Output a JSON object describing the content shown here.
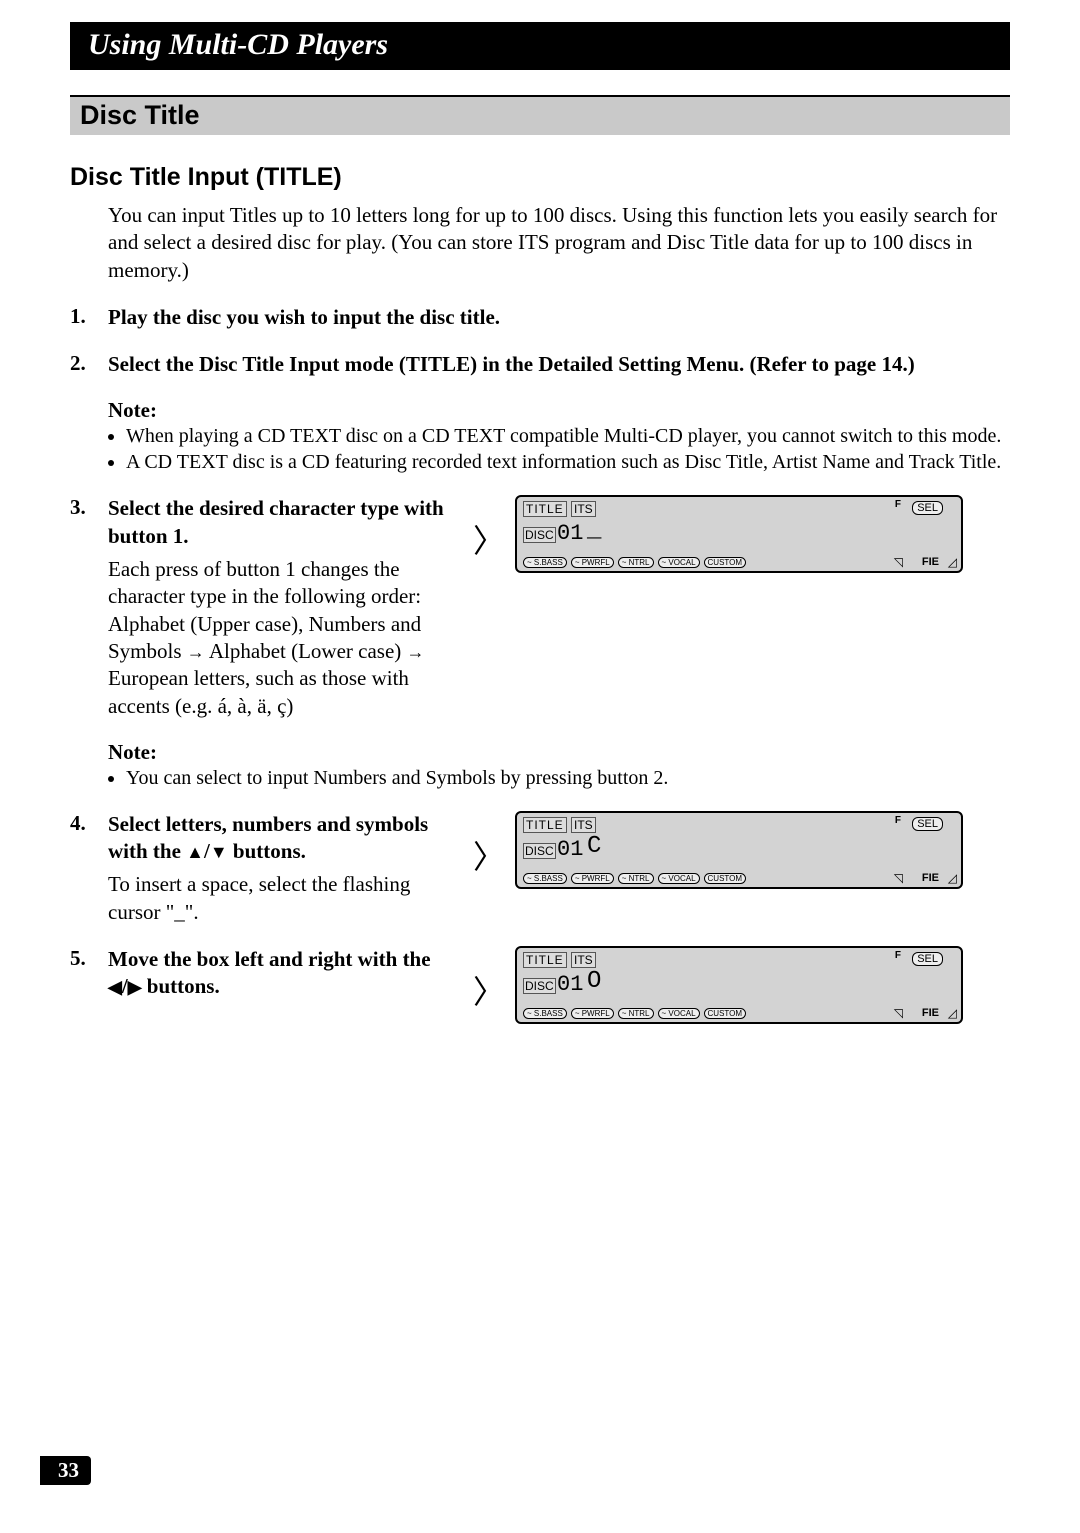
{
  "chapter_title": "Using Multi-CD Players",
  "section_title": "Disc Title",
  "subsection_title": "Disc Title Input (TITLE)",
  "intro_text": "You can input Titles up to 10 letters long for up to 100 discs. Using this function lets you easily search for and select a desired disc for play. (You can store ITS program and Disc Title data for up to 100 discs in memory.)",
  "steps": {
    "s1": {
      "num": "1.",
      "title": "Play the disc you wish to input the disc title."
    },
    "s2": {
      "num": "2.",
      "title": "Select the Disc Title Input mode (TITLE) in the Detailed Setting Menu. (Refer to page 14.)"
    },
    "note1": {
      "label": "Note:",
      "items": {
        "a": "When playing a CD TEXT disc on a CD TEXT compatible Multi-CD player, you cannot switch to this mode.",
        "b": "A CD TEXT disc is a CD featuring recorded text information such as Disc Title, Artist Name and Track Title."
      }
    },
    "s3": {
      "num": "3.",
      "title": "Select the desired character type with button 1.",
      "desc_a": "Each press of button 1 changes the character type in the following order:",
      "desc_b1": "Alphabet (Upper case), Numbers and Symbols ",
      "desc_b2": " Alphabet (Lower case) ",
      "desc_b3": " European letters, such as those with accents (e.g. á, à, ä, ç)"
    },
    "note2": {
      "label": "Note:",
      "items": {
        "a": "You can select to input Numbers and Symbols by pressing button 2."
      }
    },
    "s4": {
      "num": "4.",
      "title_a": "Select letters, numbers and symbols with the ",
      "title_b": " buttons.",
      "desc": "To insert a space, select the flashing cursor \"_\"."
    },
    "s5": {
      "num": "5.",
      "title_a": "Move the box left and right with the ",
      "title_b": " buttons."
    }
  },
  "display": {
    "title_label": "TITLE",
    "its_label": "ITS",
    "disc_label": "DISC",
    "disc_num": "01",
    "sel_label": "SEL",
    "f_label": "F",
    "fie_label": "FIE",
    "pills": {
      "sbass": "~ S.BASS",
      "pwr": "~ PWRFL",
      "ntrl": "~ NTRL",
      "vocal": "~ VOCAL",
      "custom": "CUSTOM"
    },
    "d1_cursor": "_",
    "d2_cursor": "C",
    "d3_cursor": "O"
  },
  "symbols": {
    "arrow_right": "→",
    "tri_up": "▲",
    "tri_down": "▼",
    "tri_left": "◀",
    "tri_right": "▶",
    "slash": "/"
  },
  "page_number": "33"
}
